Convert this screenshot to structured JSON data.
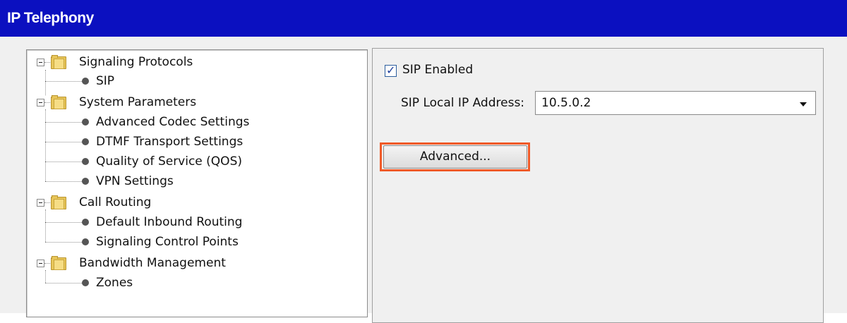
{
  "window": {
    "title": "IP Telephony",
    "accent": "#0b10c0"
  },
  "tree": {
    "items": [
      {
        "label": "Signaling Protocols",
        "type": "folder"
      },
      {
        "label": "SIP",
        "type": "leaf"
      },
      {
        "label": "System Parameters",
        "type": "folder"
      },
      {
        "label": "Advanced Codec Settings",
        "type": "leaf"
      },
      {
        "label": "DTMF Transport Settings",
        "type": "leaf"
      },
      {
        "label": "Quality of Service (QOS)",
        "type": "leaf"
      },
      {
        "label": "VPN Settings",
        "type": "leaf"
      },
      {
        "label": "Call Routing",
        "type": "folder"
      },
      {
        "label": "Default Inbound Routing",
        "type": "leaf"
      },
      {
        "label": "Signaling Control Points",
        "type": "leaf"
      },
      {
        "label": "Bandwidth Management",
        "type": "folder"
      },
      {
        "label": "Zones",
        "type": "leaf"
      }
    ]
  },
  "sip": {
    "enabled_label": "SIP Enabled",
    "enabled_checked": true,
    "local_ip_label": "SIP Local IP Address:",
    "local_ip_value": "10.5.0.2",
    "advanced_button_label": "Advanced...",
    "highlight_color": "#f05a28"
  }
}
